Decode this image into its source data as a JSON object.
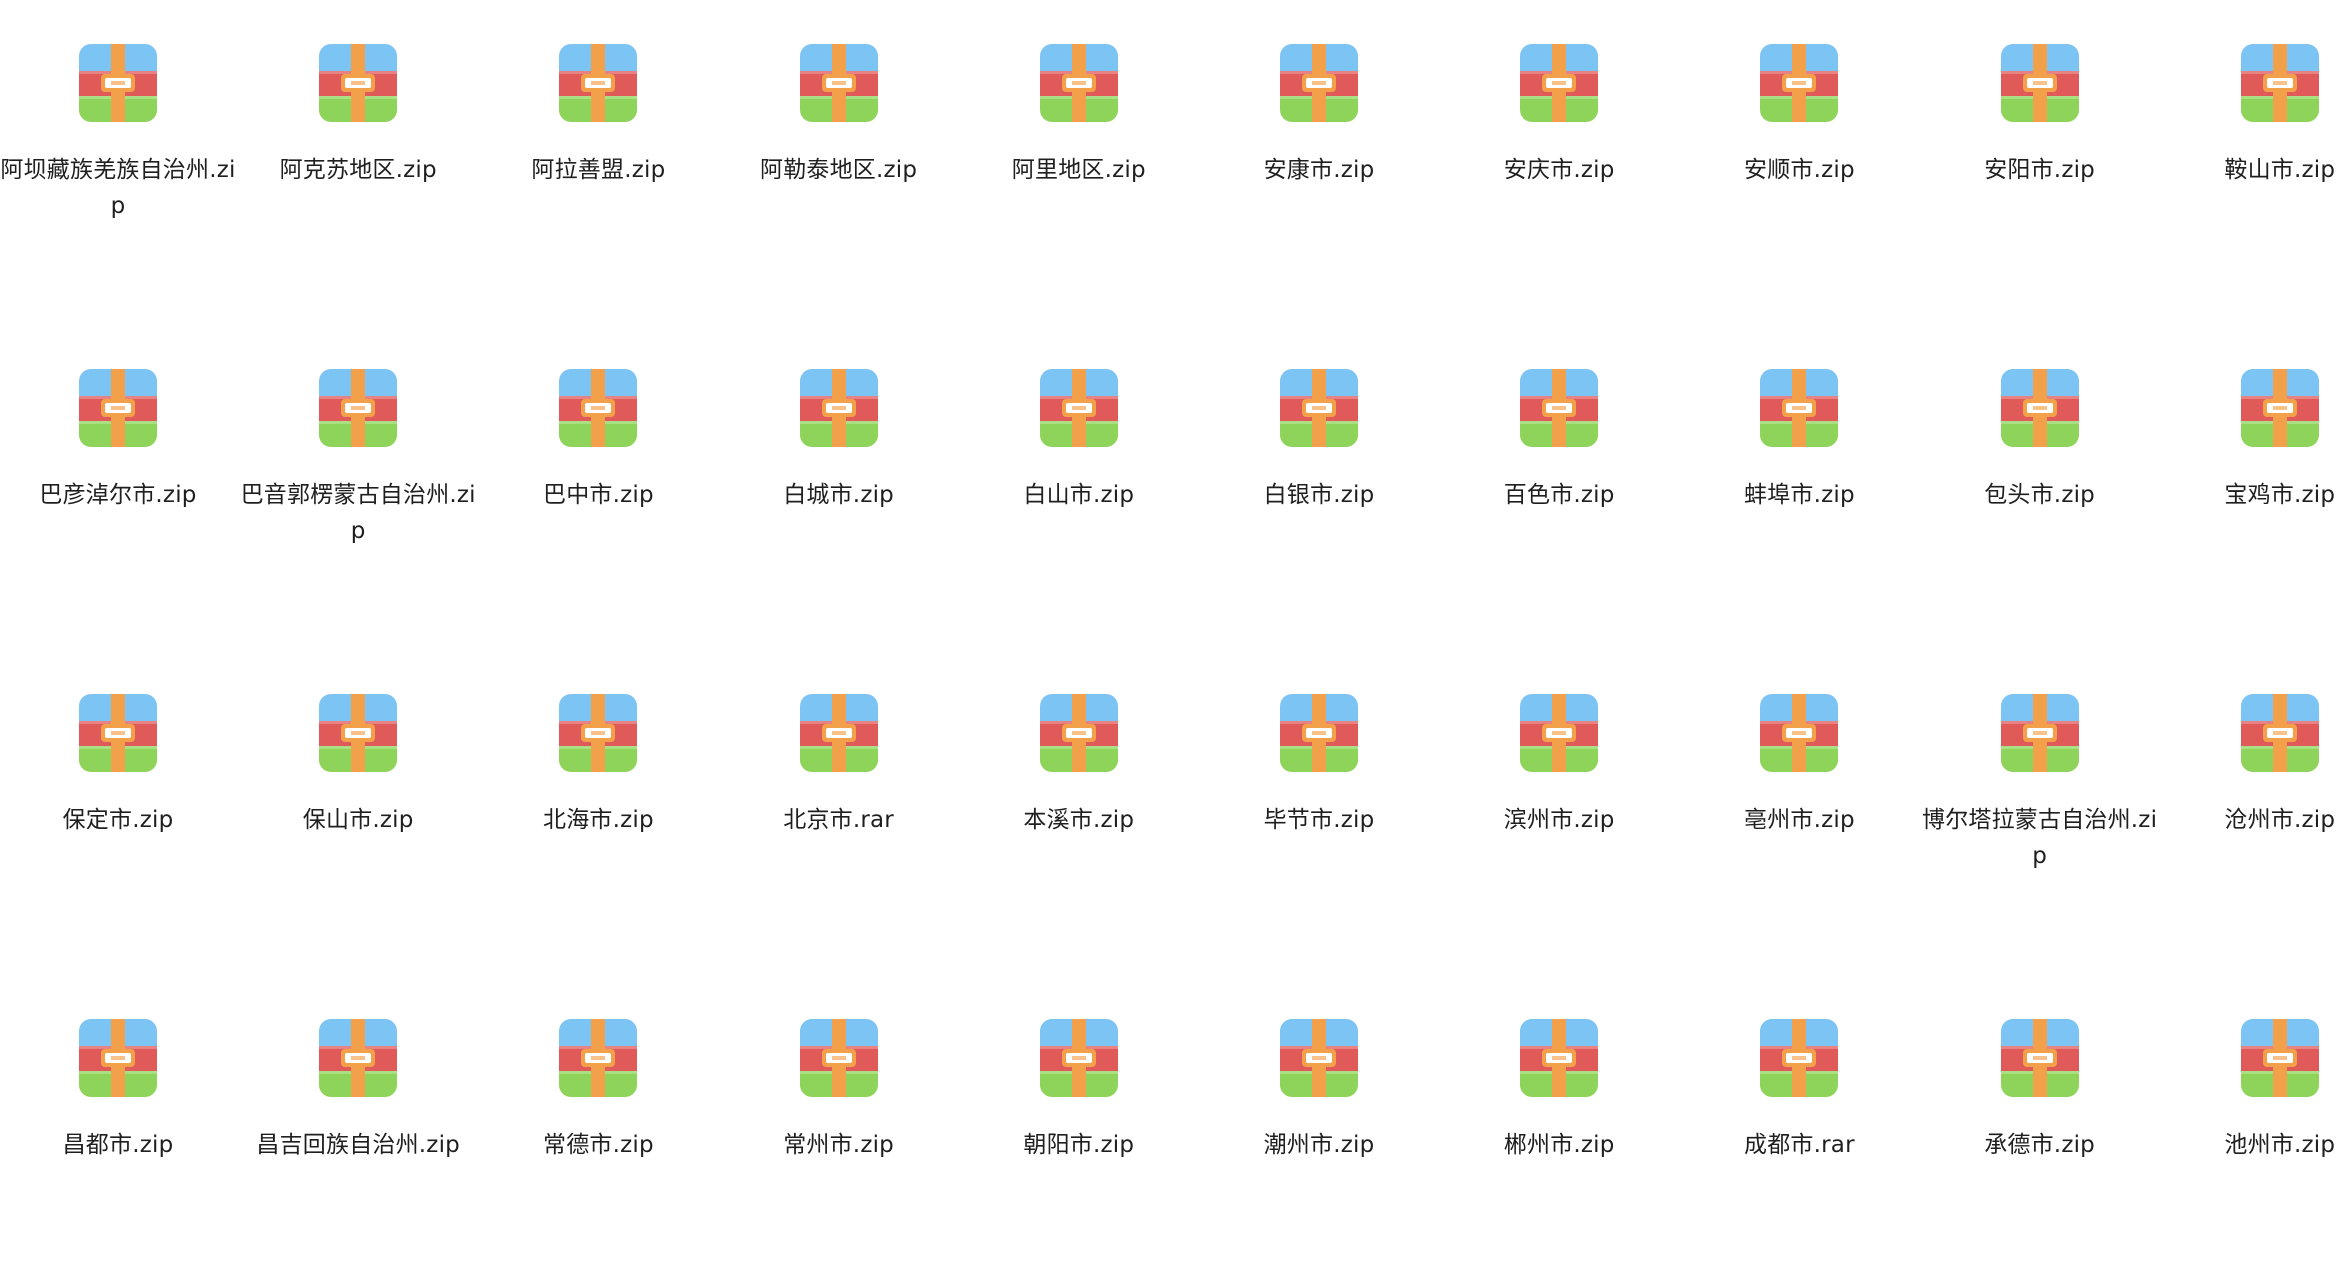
{
  "files": [
    {
      "name": "阿坝藏族羌族自治州.zip",
      "icon": "archive-icon"
    },
    {
      "name": "阿克苏地区.zip",
      "icon": "archive-icon"
    },
    {
      "name": "阿拉善盟.zip",
      "icon": "archive-icon"
    },
    {
      "name": "阿勒泰地区.zip",
      "icon": "archive-icon"
    },
    {
      "name": "阿里地区.zip",
      "icon": "archive-icon"
    },
    {
      "name": "安康市.zip",
      "icon": "archive-icon"
    },
    {
      "name": "安庆市.zip",
      "icon": "archive-icon"
    },
    {
      "name": "安顺市.zip",
      "icon": "archive-icon"
    },
    {
      "name": "安阳市.zip",
      "icon": "archive-icon"
    },
    {
      "name": "鞍山市.zip",
      "icon": "archive-icon"
    },
    {
      "name": "巴彦淖尔市.zip",
      "icon": "archive-icon"
    },
    {
      "name": "巴音郭楞蒙古自治州.zip",
      "icon": "archive-icon"
    },
    {
      "name": "巴中市.zip",
      "icon": "archive-icon"
    },
    {
      "name": "白城市.zip",
      "icon": "archive-icon"
    },
    {
      "name": "白山市.zip",
      "icon": "archive-icon"
    },
    {
      "name": "白银市.zip",
      "icon": "archive-icon"
    },
    {
      "name": "百色市.zip",
      "icon": "archive-icon"
    },
    {
      "name": "蚌埠市.zip",
      "icon": "archive-icon"
    },
    {
      "name": "包头市.zip",
      "icon": "archive-icon"
    },
    {
      "name": "宝鸡市.zip",
      "icon": "archive-icon"
    },
    {
      "name": "保定市.zip",
      "icon": "archive-icon"
    },
    {
      "name": "保山市.zip",
      "icon": "archive-icon"
    },
    {
      "name": "北海市.zip",
      "icon": "archive-icon"
    },
    {
      "name": "北京市.rar",
      "icon": "archive-icon"
    },
    {
      "name": "本溪市.zip",
      "icon": "archive-icon"
    },
    {
      "name": "毕节市.zip",
      "icon": "archive-icon"
    },
    {
      "name": "滨州市.zip",
      "icon": "archive-icon"
    },
    {
      "name": "亳州市.zip",
      "icon": "archive-icon"
    },
    {
      "name": "博尔塔拉蒙古自治州.zip",
      "icon": "archive-icon"
    },
    {
      "name": "沧州市.zip",
      "icon": "archive-icon"
    },
    {
      "name": "昌都市.zip",
      "icon": "archive-icon"
    },
    {
      "name": "昌吉回族自治州.zip",
      "icon": "archive-icon"
    },
    {
      "name": "常德市.zip",
      "icon": "archive-icon"
    },
    {
      "name": "常州市.zip",
      "icon": "archive-icon"
    },
    {
      "name": "朝阳市.zip",
      "icon": "archive-icon"
    },
    {
      "name": "潮州市.zip",
      "icon": "archive-icon"
    },
    {
      "name": "郴州市.zip",
      "icon": "archive-icon"
    },
    {
      "name": "成都市.rar",
      "icon": "archive-icon"
    },
    {
      "name": "承德市.zip",
      "icon": "archive-icon"
    },
    {
      "name": "池州市.zip",
      "icon": "archive-icon"
    }
  ],
  "colors": {
    "top": "#7cc4f4",
    "middle": "#e05a5a",
    "bottom": "#8fd45a",
    "strap": "#f2a04a",
    "label_bg": "#ffffff"
  }
}
